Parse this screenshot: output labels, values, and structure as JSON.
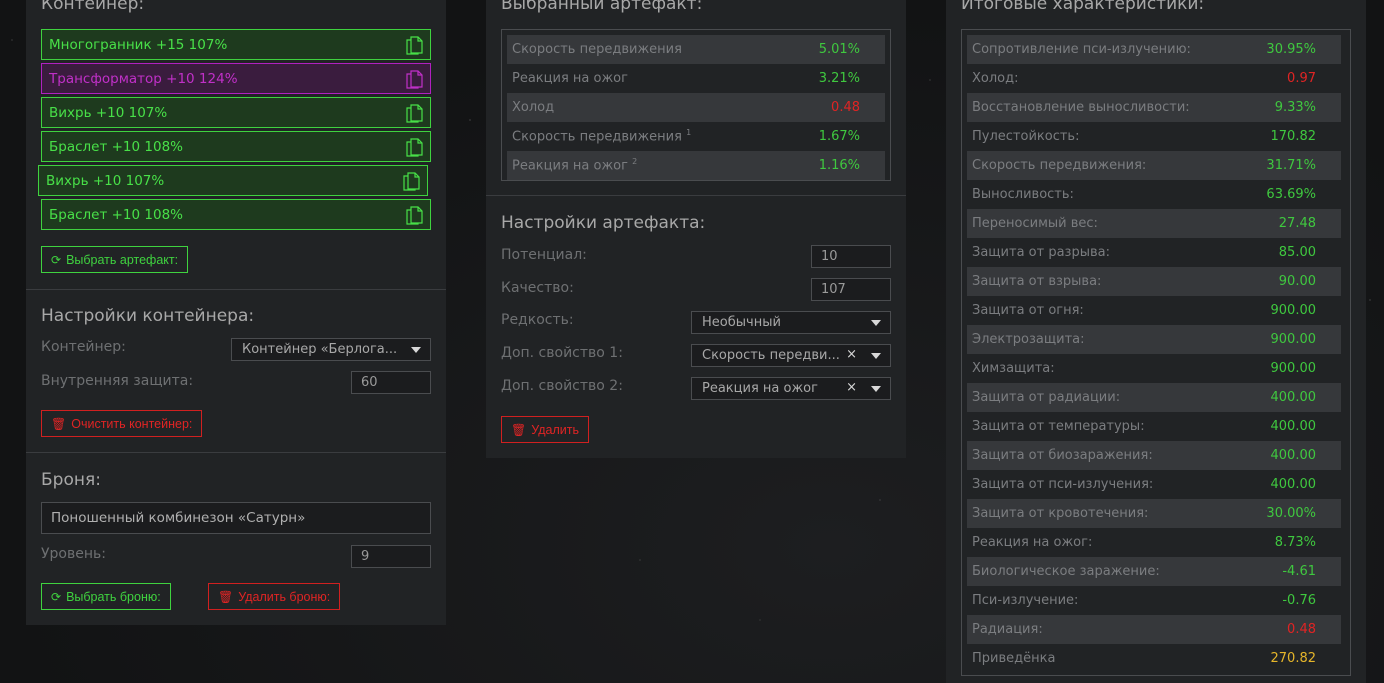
{
  "container": {
    "title": "Контейнер:",
    "artifacts": [
      {
        "label": "Многогранник +15 107%",
        "color": "green"
      },
      {
        "label": "Трансформатор +10 124%",
        "color": "purple"
      },
      {
        "label": "Вихрь +10 107%",
        "color": "green"
      },
      {
        "label": "Браслет +10 108%",
        "color": "green"
      },
      {
        "label": "Вихрь +10 107%",
        "color": "green"
      },
      {
        "label": "Браслет +10 108%",
        "color": "green"
      }
    ],
    "select_button": "Выбрать артефакт:",
    "settings_title": "Настройки контейнера:",
    "container_label": "Контейнер:",
    "container_value": "Контейнер «Берлога...",
    "protection_label": "Внутренняя защита:",
    "protection_value": "60",
    "clear_button": "Очистить контейнер:"
  },
  "armor": {
    "title": "Броня:",
    "name": "Поношенный комбинезон «Сатурн»",
    "level_label": "Уровень:",
    "level_value": "9",
    "select_button": "Выбрать броню:",
    "delete_button": "Удалить броню:"
  },
  "selected": {
    "title": "Выбранный артефакт:",
    "stats": [
      {
        "name": "Скорость передвижения",
        "sup": "",
        "value": "5.01%",
        "color": "green"
      },
      {
        "name": "Реакция на ожог",
        "sup": "",
        "value": "3.21%",
        "color": "green"
      },
      {
        "name": "Холод",
        "sup": "",
        "value": "0.48",
        "color": "red"
      },
      {
        "name": "Скорость передвижения",
        "sup": "1",
        "value": "1.67%",
        "color": "green"
      },
      {
        "name": "Реакция на ожог",
        "sup": "2",
        "value": "1.16%",
        "color": "green"
      }
    ],
    "settings_title": "Настройки артефакта:",
    "potential_label": "Потенциал:",
    "potential_value": "10",
    "quality_label": "Качество:",
    "quality_value": "107",
    "rarity_label": "Редкость:",
    "rarity_value": "Необычный",
    "prop1_label": "Доп. свойство 1:",
    "prop1_value": "Скорость передви...",
    "prop2_label": "Доп. свойство 2:",
    "prop2_value": "Реакция на ожог",
    "delete_button": "Удалить"
  },
  "totals": {
    "title": "Итоговые характеристики:",
    "stats": [
      {
        "name": "Сопротивление пси-излучению:",
        "value": "30.95%",
        "color": "green"
      },
      {
        "name": "Холод:",
        "value": "0.97",
        "color": "red"
      },
      {
        "name": "Восстановление выносливости:",
        "value": "9.33%",
        "color": "green"
      },
      {
        "name": "Пулестойкость:",
        "value": "170.82",
        "color": "green"
      },
      {
        "name": "Скорость передвижения:",
        "value": "31.71%",
        "color": "green"
      },
      {
        "name": "Выносливость:",
        "value": "63.69%",
        "color": "green"
      },
      {
        "name": "Переносимый вес:",
        "value": "27.48",
        "color": "green"
      },
      {
        "name": "Защита от разрыва:",
        "value": "85.00",
        "color": "green"
      },
      {
        "name": "Защита от взрыва:",
        "value": "90.00",
        "color": "green"
      },
      {
        "name": "Защита от огня:",
        "value": "900.00",
        "color": "green"
      },
      {
        "name": "Электрозащита:",
        "value": "900.00",
        "color": "green"
      },
      {
        "name": "Химзащита:",
        "value": "900.00",
        "color": "green"
      },
      {
        "name": "Защита от радиации:",
        "value": "400.00",
        "color": "green"
      },
      {
        "name": "Защита от температуры:",
        "value": "400.00",
        "color": "green"
      },
      {
        "name": "Защита от биозаражения:",
        "value": "400.00",
        "color": "green"
      },
      {
        "name": "Защита от пси-излучения:",
        "value": "400.00",
        "color": "green"
      },
      {
        "name": "Защита от кровотечения:",
        "value": "30.00%",
        "color": "green"
      },
      {
        "name": "Реакция на ожог:",
        "value": "8.73%",
        "color": "green"
      },
      {
        "name": "Биологическое заражение:",
        "value": "-4.61",
        "color": "green"
      },
      {
        "name": "Пси-излучение:",
        "value": "-0.76",
        "color": "green"
      },
      {
        "name": "Радиация:",
        "value": "0.48",
        "color": "red"
      },
      {
        "name": "Приведёнка",
        "value": "270.82",
        "color": "yellow"
      }
    ]
  },
  "colors": {
    "accent_green": "#3fd23f",
    "danger_red": "#e02424",
    "purple": "#c030c8",
    "yellow": "#e5b52a"
  },
  "icons": {
    "copy": "copy-icon",
    "refresh": "refresh-icon",
    "trash": "trash-icon",
    "caret": "caret-down-icon",
    "clear": "clear-icon"
  }
}
